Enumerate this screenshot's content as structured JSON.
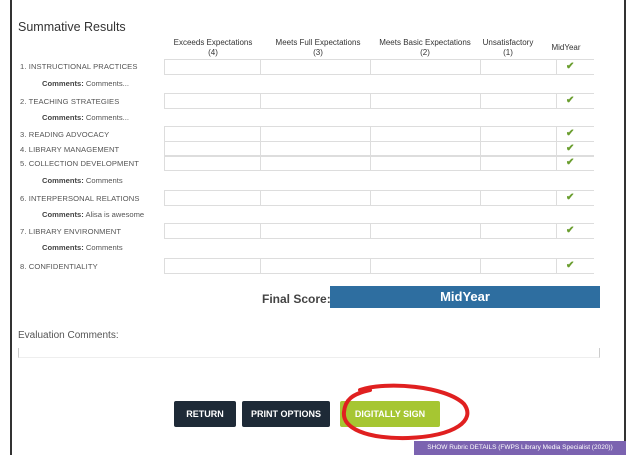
{
  "title": "Summative Results",
  "columns": {
    "exceeds": "Exceeds Expectations",
    "exceeds_score": "(4)",
    "meets": "Meets Full Expectations",
    "meets_score": "(3)",
    "basic": "Meets Basic Expectations",
    "basic_score": "(2)",
    "unsat": "Unsatisfactory",
    "unsat_score": "(1)",
    "midyear": "MidYear"
  },
  "rows": [
    {
      "label": "1. INSTRUCTIONAL PRACTICES",
      "comment_label": "Comments:",
      "comment": "Comments..."
    },
    {
      "label": "2. TEACHING STRATEGIES",
      "comment_label": "Comments:",
      "comment": "Comments..."
    },
    {
      "label": "3. READING ADVOCACY"
    },
    {
      "label": "4. LIBRARY MANAGEMENT"
    },
    {
      "label": "5. COLLECTION DEVELOPMENT",
      "comment_label": "Comments:",
      "comment": "Comments"
    },
    {
      "label": "6. INTERPERSONAL RELATIONS",
      "comment_label": "Comments:",
      "comment": "Alisa is awesome"
    },
    {
      "label": "7. LIBRARY ENVIRONMENT",
      "comment_label": "Comments:",
      "comment": "Comments"
    },
    {
      "label": "8. CONFIDENTIALITY"
    }
  ],
  "check_glyph": "✔",
  "final": {
    "label": "Final Score:",
    "value": "MidYear"
  },
  "evaluation": {
    "label": "Evaluation Comments:"
  },
  "buttons": {
    "return": "RETURN",
    "print": "PRINT OPTIONS",
    "sign": "DIGITALLY SIGN"
  },
  "footer": "SHOW Rubric DETAILS (FWPS Library Media Specialist (2020))",
  "colors": {
    "accent": "#2e6ea0",
    "sign": "#a6c632",
    "dark_button": "#1e2a37",
    "annotation": "#e02020",
    "footer": "#7b63b0"
  }
}
